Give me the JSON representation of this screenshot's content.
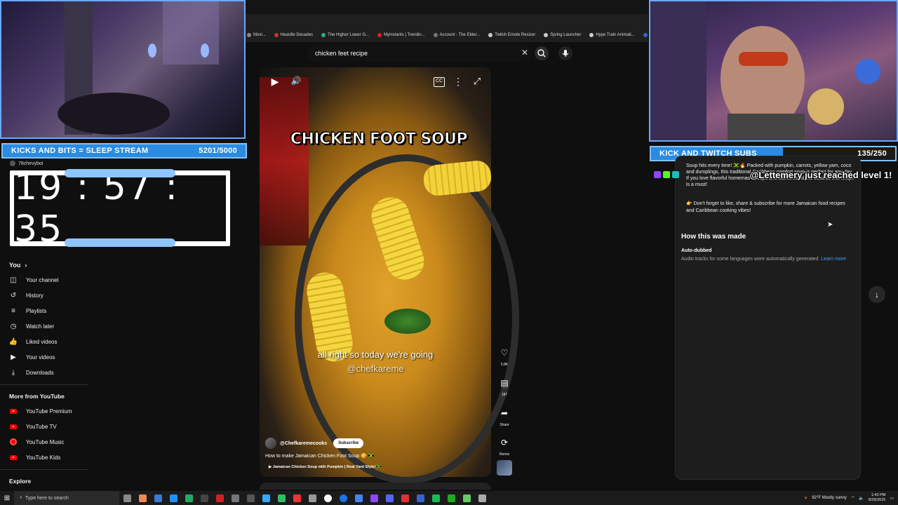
{
  "browser": {
    "bookmarks": [
      {
        "label": "Movi...",
        "color": "#888"
      },
      {
        "label": "Heardle Decades",
        "color": "#c33"
      },
      {
        "label": "The Higher Lower G...",
        "color": "#3a8"
      },
      {
        "label": "Myinstants | Trendin...",
        "color": "#d22"
      },
      {
        "label": "Account - The Elder...",
        "color": "#777"
      },
      {
        "label": "Twitch Emote Resizer",
        "color": "#ccc"
      },
      {
        "label": "Spring Launcher",
        "color": "#ccc"
      },
      {
        "label": "Hype Train Animati...",
        "color": "#ccc"
      },
      {
        "label": "Dj Drops.e",
        "color": "#36c"
      }
    ],
    "search_query": "chicken feet recipe",
    "clear_icon": "close-icon",
    "search_icon": "search-icon",
    "mic_icon": "mic-icon"
  },
  "overlay": {
    "left_goal_label": "KICKS AND BITS = SLEEP STREAM",
    "left_goal_count": "5201/5000",
    "right_goal_label": "KICK AND TWITCH SUBS",
    "right_goal_count": "135/250",
    "right_goal_progress": 0.54,
    "timer": "19 : 57 : 35",
    "chat_user": "78chevyboi",
    "alert_text": "@Lettemery just reached level 1!"
  },
  "sidebar": {
    "you_label": "You",
    "you_items": [
      {
        "label": "Your channel",
        "icon": "channel-icon"
      },
      {
        "label": "History",
        "icon": "history-icon"
      },
      {
        "label": "Playlists",
        "icon": "playlists-icon"
      },
      {
        "label": "Watch later",
        "icon": "clock-icon"
      },
      {
        "label": "Liked videos",
        "icon": "thumbs-up-icon"
      },
      {
        "label": "Your videos",
        "icon": "video-icon"
      },
      {
        "label": "Downloads",
        "icon": "download-icon"
      }
    ],
    "more_title": "More from YouTube",
    "more_items": [
      {
        "label": "YouTube Premium"
      },
      {
        "label": "YouTube TV"
      },
      {
        "label": "YouTube Music"
      },
      {
        "label": "YouTube Kids"
      }
    ],
    "explore_label": "Explore"
  },
  "short": {
    "overlay_title": "CHICKEN FOOT SOUP",
    "caption": "all right so today we're going",
    "watermark": "@chefkareme",
    "channel": "@Chefkaremecooks",
    "subscribe_label": "Subscribe",
    "title": "How to make Jamaican Chicken Foot Soup 😋 🇯🇲",
    "link": "Jamaican Chicken Soup with Pumpkin | Real Yard Style! 🇯🇲",
    "actions": [
      {
        "count": "5.8K",
        "icon": "like-icon"
      },
      {
        "count": "187",
        "icon": "comment-icon"
      },
      {
        "count": "Share",
        "icon": "share-icon"
      },
      {
        "count": "Remix",
        "icon": "remix-icon"
      }
    ],
    "cc_label": "CC"
  },
  "description": {
    "text": "Soup hits every time! 🇯🇲🔥 Packed with pumpkin, carrots, yellow yam, coco and dumplings, this traditional Caribbean comfort soup is perfect for any day. If you love flavorful homemade soups and authentic island cuisine, this recipe is a must!",
    "cta": "👉 Don't forget to like, share & subscribe for more Jamaican food recipes and Caribbean cooking vibes!",
    "how_title": "How this was made",
    "auto_dubbed": "Auto-dubbed",
    "auto_desc": "Audio tracks for some languages were automatically generated.",
    "learn_more": "Learn more"
  },
  "taskbar": {
    "search_placeholder": "Type here to search",
    "weather": "92°F  Mostly sunny",
    "time": "1:43 PM",
    "date": "8/29/2025"
  }
}
